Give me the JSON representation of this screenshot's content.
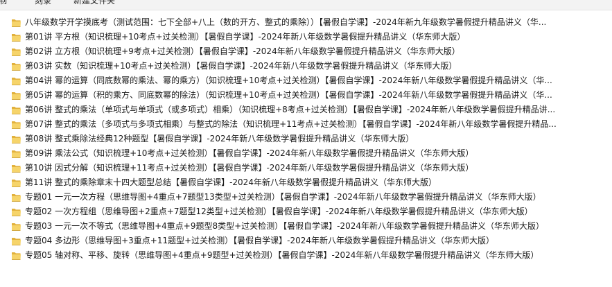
{
  "toolbar": {
    "items": [
      "制",
      "刻录",
      "新建文件夹"
    ]
  },
  "colors": {
    "folder_back": "#e2b13c",
    "folder_front": "#f6d46a",
    "text": "#1a1a1a"
  },
  "files": [
    {
      "name": "八年级数学开学摸底考（测试范围：七下全部+八上（数的开方、整式的乘除））【暑假自学课】-2024年新九年级数学暑假提升精品讲义（华..."
    },
    {
      "name": "第01讲 平方根（知识梳理+10考点+过关检测）【暑假自学课】-2024年新八年级数学暑假提升精品讲义（华东师大版）"
    },
    {
      "name": "第02讲 立方根（知识梳理+9考点+过关检测）【暑假自学课】-2024年新八年级数学暑假提升精品讲义（华东师大版）"
    },
    {
      "name": "第03讲 实数（知识梳理+10考点+过关检测）【暑假自学课】-2024年新八年级数学暑假提升精品讲义（华东师大版）"
    },
    {
      "name": "第04讲 幂的运算（同底数幂的乘法、幂的乘方）（知识梳理+10考点+过关检测）【暑假自学课】-2024年新八年级数学暑假提升精品讲义（华..."
    },
    {
      "name": "第05讲 幂的运算（积的乘方、同底数幂的除法）（知识梳理+10考点+过关检测）【暑假自学课】-2024年新八年级数学暑假提升精品讲义（华..."
    },
    {
      "name": "第06讲 整式的乘法（单项式与单项式（或多项式）相乘）（知识梳理+8考点+过关检测）【暑假自学课】-2024年新八年级数学暑假提升精品讲..."
    },
    {
      "name": "第07讲 整式的乘法（多项式与多项式相乘）与整式的除法（知识梳理+11考点+过关检测）【暑假自学课】-2024年新八年级数学暑假提升精品..."
    },
    {
      "name": "第08讲 整式乘除法经典12种题型【暑假自学课】-2024年新八年级数学暑假提升精品讲义（华东师大版）"
    },
    {
      "name": "第09讲 乘法公式（知识梳理+10考点+过关检测）【暑假自学课】-2024年新八年级数学暑假提升精品讲义（华东师大版）"
    },
    {
      "name": "第10讲 因式分解（知识梳理+11考点+过关检测）【暑假自学课】-2024年新八年级数学暑假提升精品讲义（华东师大版）"
    },
    {
      "name": "第11讲 整式的乘除章末十四大题型总结【暑假自学课】-2024年新八年级数学暑假提升精品讲义（华东师大版）"
    },
    {
      "name": "专题01 一元一次方程（思维导图+4重点+7题型13类型+过关检测）【暑假自学课】-2024年新八年级数学暑假提升精品讲义（华东师大版）"
    },
    {
      "name": "专题02 一次方程组（思维导图+2重点+7题型12类型+过关检测）【暑假自学课】-2024年新八年级数学暑假提升精品讲义（华东师大版）"
    },
    {
      "name": "专题03 一元一次不等式（思维导图+4重点+9题型8类型+过关检测）【暑假自学课】-2024年新八年级数学暑假提升精品讲义（华东师大版）"
    },
    {
      "name": "专题04 多边形（思维导图+3重点+11题型+过关检测）【暑假自学课】-2024年新八年级数学暑假提升精品讲义（华东师大版）"
    },
    {
      "name": "专题05 轴对称、平移、旋转（思维导图+4重点+9题型+过关检测）【暑假自学课】-2024年新八年级数学暑假提升精品讲义（华东师大版）"
    }
  ]
}
